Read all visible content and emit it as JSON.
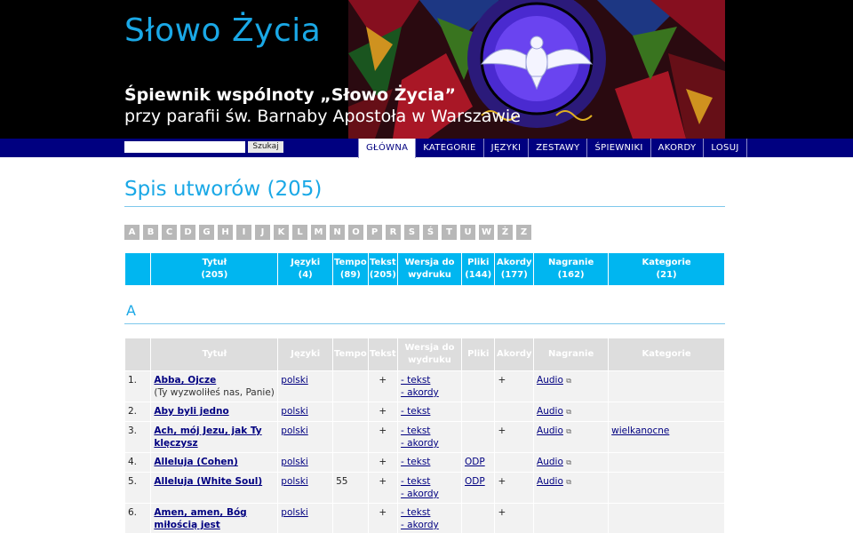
{
  "header": {
    "site_title": "Słowo Życia",
    "subtitle1": "Śpiewnik wspólnoty „Słowo Życia”",
    "subtitle2": "przy parafii św. Barnaby Apostoła w Warszawie"
  },
  "search": {
    "placeholder": "",
    "button": "Szukaj"
  },
  "nav": [
    "GŁÓWNA",
    "KATEGORIE",
    "JĘZYKI",
    "ZESTAWY",
    "ŚPIEWNIKI",
    "AKORDY",
    "LOSUJ"
  ],
  "page": {
    "heading": "Spis utworów (205)",
    "letter_heading": "A"
  },
  "letters": [
    "A",
    "B",
    "C",
    "D",
    "G",
    "H",
    "I",
    "J",
    "K",
    "L",
    "M",
    "N",
    "O",
    "P",
    "R",
    "S",
    "Ś",
    "T",
    "U",
    "W",
    "Ż",
    "Z"
  ],
  "summary": {
    "c0": "",
    "c1a": "Tytuł",
    "c1b": "(205)",
    "c2a": "Języki",
    "c2b": "(4)",
    "c3a": "Tempo",
    "c3b": "(89)",
    "c4a": "Tekst",
    "c4b": "(205)",
    "c5a": "Wersja do",
    "c5b": "wydruku",
    "c6a": "Pliki",
    "c6b": "(144)",
    "c7a": "Akordy",
    "c7b": "(177)",
    "c8a": "Nagranie",
    "c8b": "(162)",
    "c9a": "Kategorie",
    "c9b": "(21)"
  },
  "table_headers": {
    "title": "Tytuł",
    "lang": "Języki",
    "tempo": "Tempo",
    "text": "Tekst",
    "print_a": "Wersja do",
    "print_b": "wydruku",
    "files": "Pliki",
    "chords": "Akordy",
    "recording": "Nagranie",
    "categories": "Kategorie"
  },
  "songs": [
    {
      "num": "1.",
      "title": "Abba, Ojcze",
      "sub": "(Ty wyzwoliłeś nas, Panie)",
      "lang": "polski",
      "tempo": "",
      "text": "+",
      "p1": "- tekst",
      "p2": "- akordy",
      "files": "",
      "chords": "+",
      "rec": "Audio",
      "cat": ""
    },
    {
      "num": "2.",
      "title": "Aby byli jedno",
      "sub": "",
      "lang": "polski",
      "tempo": "",
      "text": "+",
      "p1": "- tekst",
      "p2": "",
      "files": "",
      "chords": "",
      "rec": "Audio",
      "cat": ""
    },
    {
      "num": "3.",
      "title": "Ach, mój Jezu, jak Ty klęczysz",
      "sub": "",
      "lang": "polski",
      "tempo": "",
      "text": "+",
      "p1": "- tekst",
      "p2": "- akordy",
      "files": "",
      "chords": "+",
      "rec": "Audio",
      "cat": "wielkanocne"
    },
    {
      "num": "4.",
      "title": "Alleluja (Cohen)",
      "sub": "",
      "lang": "polski",
      "tempo": "",
      "text": "+",
      "p1": "- tekst",
      "p2": "",
      "files": "ODP",
      "chords": "",
      "rec": "Audio",
      "cat": ""
    },
    {
      "num": "5.",
      "title": "Alleluja (White Soul)",
      "sub": "",
      "lang": "polski",
      "tempo": "55",
      "text": "+",
      "p1": "- tekst",
      "p2": "- akordy",
      "files": "ODP",
      "chords": "+",
      "rec": "Audio",
      "cat": ""
    },
    {
      "num": "6.",
      "title": "Amen, amen, Bóg miłością jest",
      "sub": "",
      "lang": "polski",
      "tempo": "",
      "text": "+",
      "p1": "- tekst",
      "p2": "- akordy",
      "files": "",
      "chords": "+",
      "rec": "",
      "cat": ""
    }
  ],
  "icons": {
    "external_link": "external-link-icon"
  },
  "colors": {
    "accent": "#1aa8e6",
    "nav": "#000080",
    "summary_header": "#00b6f0"
  }
}
